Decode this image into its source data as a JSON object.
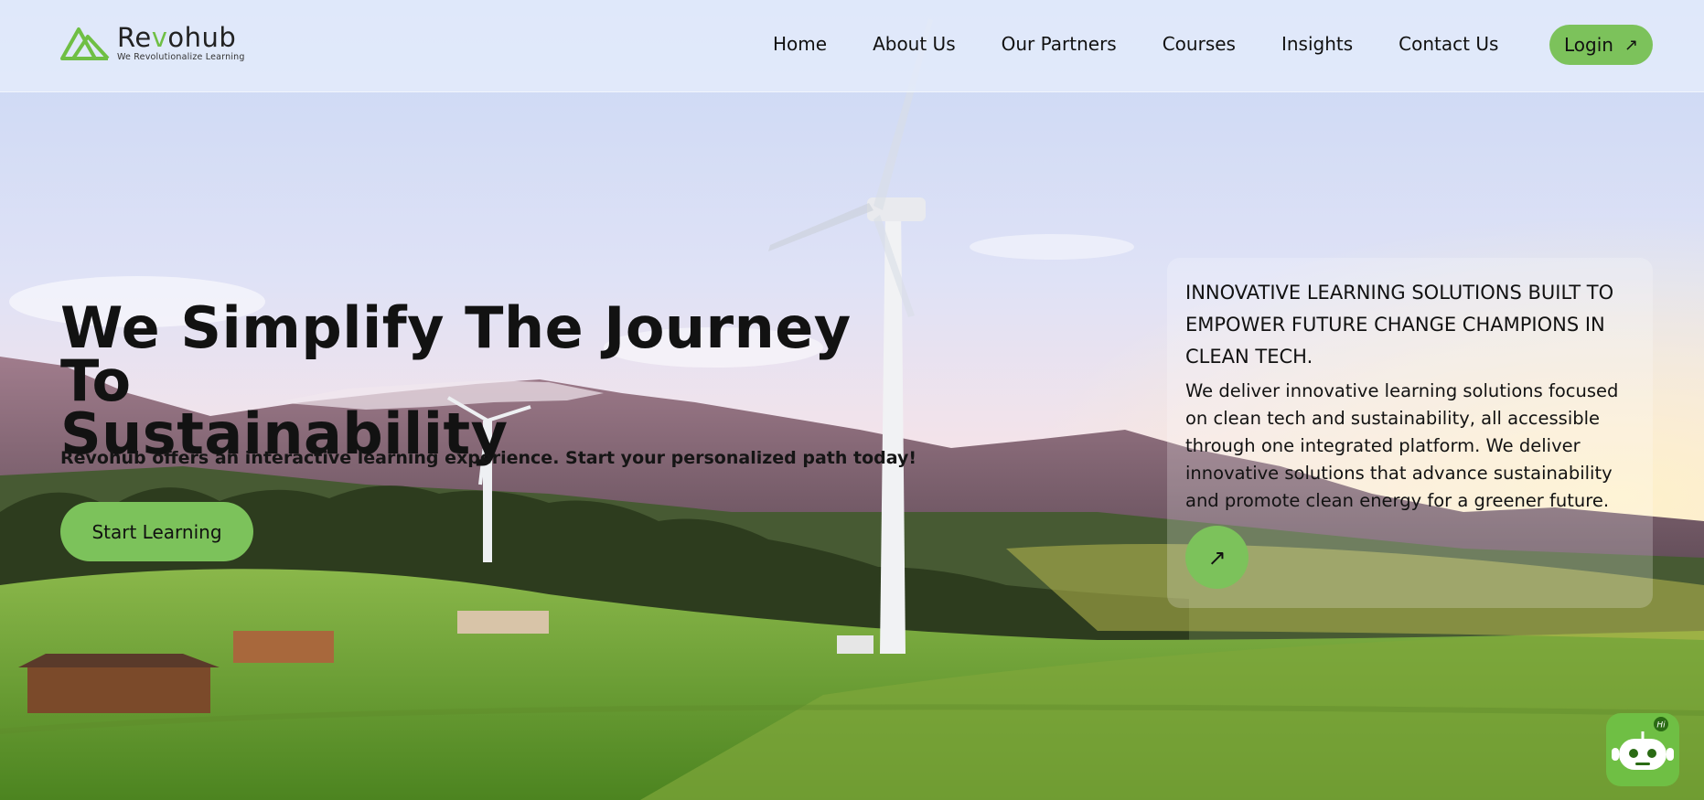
{
  "brand": {
    "name_prefix": "Re",
    "name_accent": "v",
    "name_suffix": "ohub",
    "tagline": "We Revolutionalize Learning",
    "accent_color": "#7cc25b"
  },
  "nav": {
    "items": [
      "Home",
      "About Us",
      "Our Partners",
      "Courses",
      "Insights",
      "Contact Us"
    ],
    "login_label": "Login",
    "login_icon": "arrow-up-right-icon"
  },
  "hero": {
    "title_line1": "We Simplify The Journey To",
    "title_line2": "Sustainability",
    "subtitle": "Revohub offers an interactive learning experience. Start your personalized path today!",
    "cta_label": "Start Learning"
  },
  "card": {
    "title": "INNOVATIVE LEARNING SOLUTIONS BUILT TO EMPOWER FUTURE CHANGE CHAMPIONS IN CLEAN TECH.",
    "body": "We deliver innovative learning solutions focused on clean tech and sustainability, all accessible through one integrated platform. We deliver innovative solutions that advance sustainability and promote clean energy for a greener future.",
    "button_icon": "arrow-up-right-icon"
  },
  "chatbot": {
    "badge": "Hi",
    "icon": "robot-icon"
  }
}
